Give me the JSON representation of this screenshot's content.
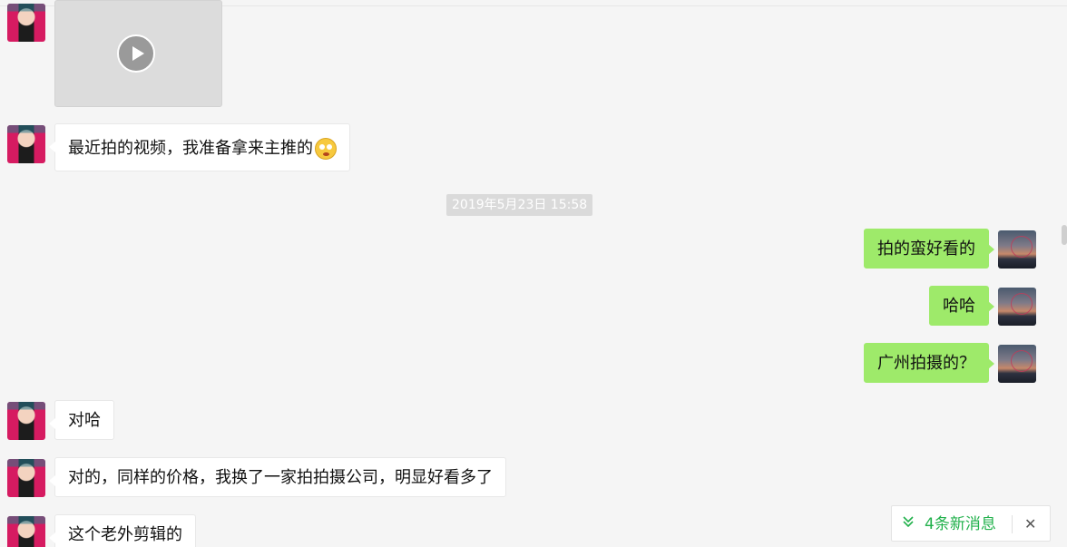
{
  "messages": {
    "m1": {
      "text": "最近拍的视频，我准备拿来主推的"
    },
    "timestamp": "2019年5月23日 15:58",
    "m2": {
      "text": "拍的蛮好看的"
    },
    "m3": {
      "text": "哈哈"
    },
    "m4": {
      "text": "广州拍摄的？"
    },
    "m5": {
      "text": "对哈"
    },
    "m6": {
      "text": "对的，同样的价格，我换了一家拍拍摄公司，明显好看多了"
    },
    "m7": {
      "text": "这个老外剪辑的"
    }
  },
  "notification": {
    "label": "4条新消息",
    "icon": "double-chevron-down-icon",
    "close_icon": "close-icon",
    "close_glyph": "✕",
    "chevron_glyph": "⌄"
  },
  "colors": {
    "background": "#f5f5f5",
    "incoming_bubble": "#ffffff",
    "outgoing_bubble": "#9eea6a",
    "accent_green": "#22b14c",
    "timestamp_bg": "#dadada"
  }
}
